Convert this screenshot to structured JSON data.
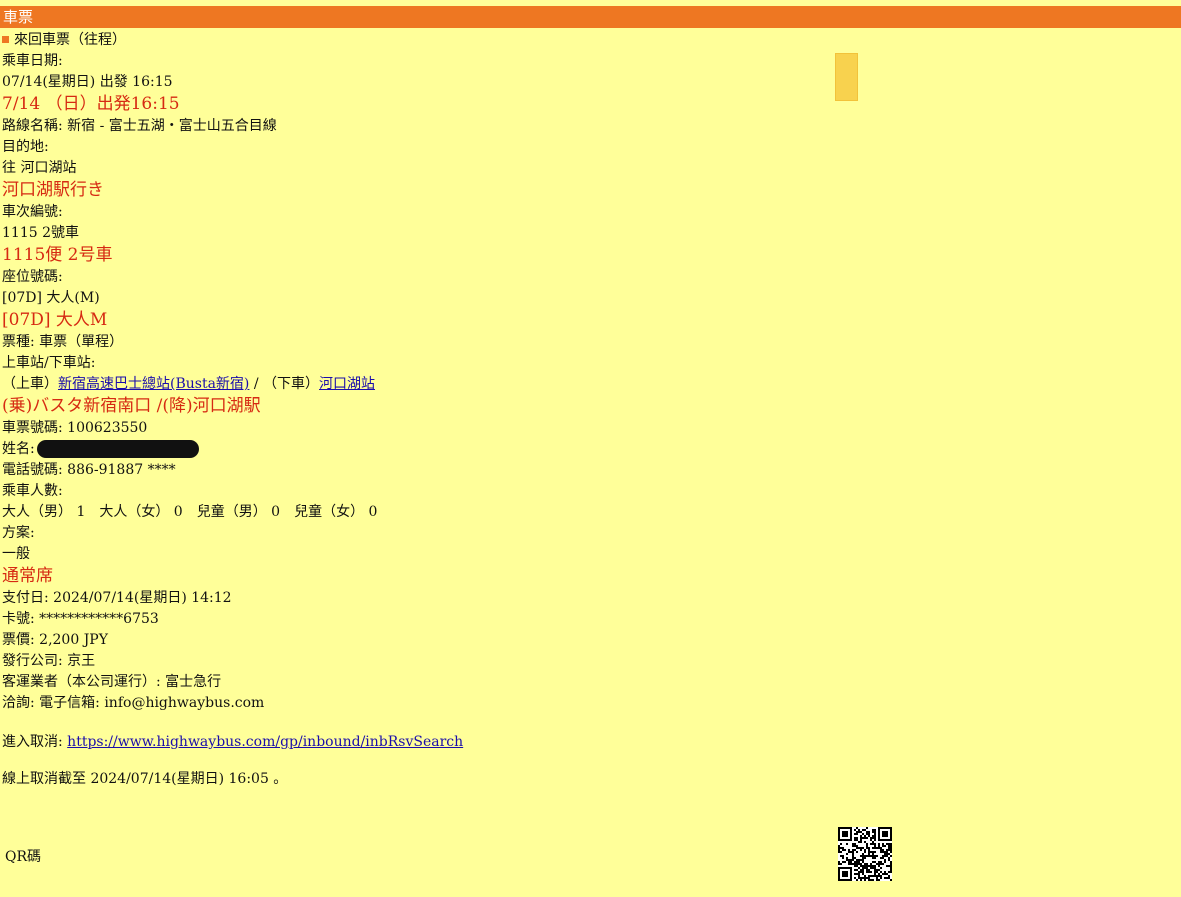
{
  "header": {
    "title": "車票"
  },
  "ticket": {
    "trip_type": "來回車票（往程）",
    "ride_date_label": "乘車日期:",
    "ride_date": "07/14(星期日) 出發 16:15",
    "ride_date_jp": "7/14 （日）出発16:15",
    "route": "路線名稱: 新宿 - 富士五湖・富士山五合目線",
    "destination_label": "目的地:",
    "destination": "往 河口湖站",
    "destination_jp": "河口湖駅行き",
    "bus_no_label": "車次編號:",
    "bus_no": "1115 2號車",
    "bus_no_jp": "1115便 2号車",
    "seat_label": "座位號碼:",
    "seat": "[07D] 大人(M)",
    "seat_jp": "[07D] 大人M",
    "ticket_type": "票種: 車票（單程）",
    "stops_label": "上車站/下車站:",
    "board_prefix": "（上車）",
    "board_link": "新宿高速巴士總站(Busta新宿)",
    "sep": " / ",
    "alight_prefix": "（下車）",
    "alight_link": "河口湖站",
    "stops_jp": "(乗)バスタ新宿南口 /(降)河口湖駅",
    "ticket_no": "車票號碼: 100623550",
    "name_label": "姓名: ",
    "phone": "電話號碼: 886-91887 ****",
    "passengers_label": "乘車人數:",
    "passengers": "大人（男） 1　大人（女） 0　兒童（男） 0　兒童（女） 0",
    "plan_label": "方案:",
    "plan": "一般",
    "plan_jp": "通常席",
    "paid_date": "支付日: 2024/07/14(星期日) 14:12",
    "card": "卡號: ************6753",
    "price": "票價: 2,200 JPY",
    "issuer": "發行公司: 京王",
    "operator": "客運業者（本公司運行）: 富士急行",
    "contact": "洽詢: 電子信箱: info@highwaybus.com",
    "cancel_label": "進入取消: ",
    "cancel_url": "https://www.highwaybus.com/gp/inbound/inbRsvSearch",
    "cancel_deadline": "線上取消截至 2024/07/14(星期日) 16:05 。",
    "qr_label": "QR碼"
  }
}
